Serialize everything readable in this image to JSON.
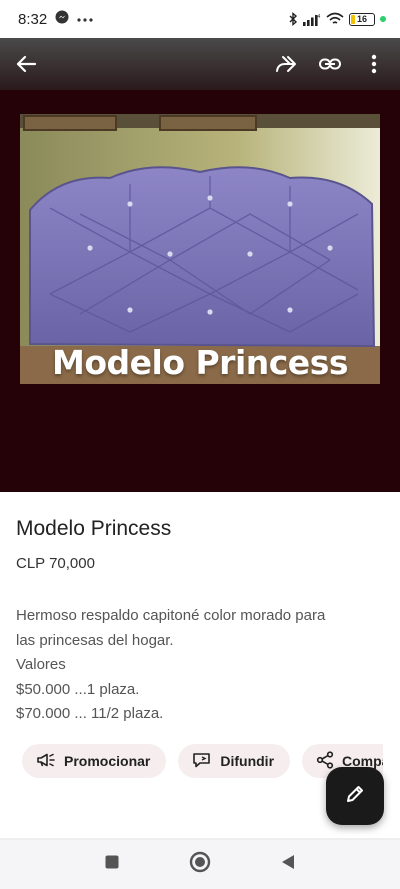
{
  "status_bar": {
    "time": "8:32",
    "battery": "16",
    "icons": [
      "messenger-icon",
      "more-dots-icon",
      "bluetooth-icon",
      "signal-icon",
      "wifi-icon",
      "battery-icon",
      "dot-indicator-icon"
    ]
  },
  "app_bar": {
    "icons": [
      "back-arrow-icon",
      "forward-icon",
      "link-icon",
      "more-vertical-icon"
    ]
  },
  "gallery": {
    "caption": "Modelo Princess",
    "background_color": "#240208"
  },
  "product": {
    "title": "Modelo Princess",
    "price": "CLP 70,000",
    "description_lines": [
      "Hermoso respaldo capitoné color morado para",
      "las princesas del hogar.",
      "Valores",
      "$50.000 ...1 plaza.",
      "$70.000 ... 11/2 plaza."
    ]
  },
  "actions": {
    "promote": "Promocionar",
    "broadcast": "Difundir",
    "share": "Compart"
  },
  "fab": {
    "icon": "edit-pencil-icon"
  },
  "nav_bar": {
    "icons": [
      "recents-square-icon",
      "home-circle-icon",
      "back-triangle-icon"
    ]
  }
}
